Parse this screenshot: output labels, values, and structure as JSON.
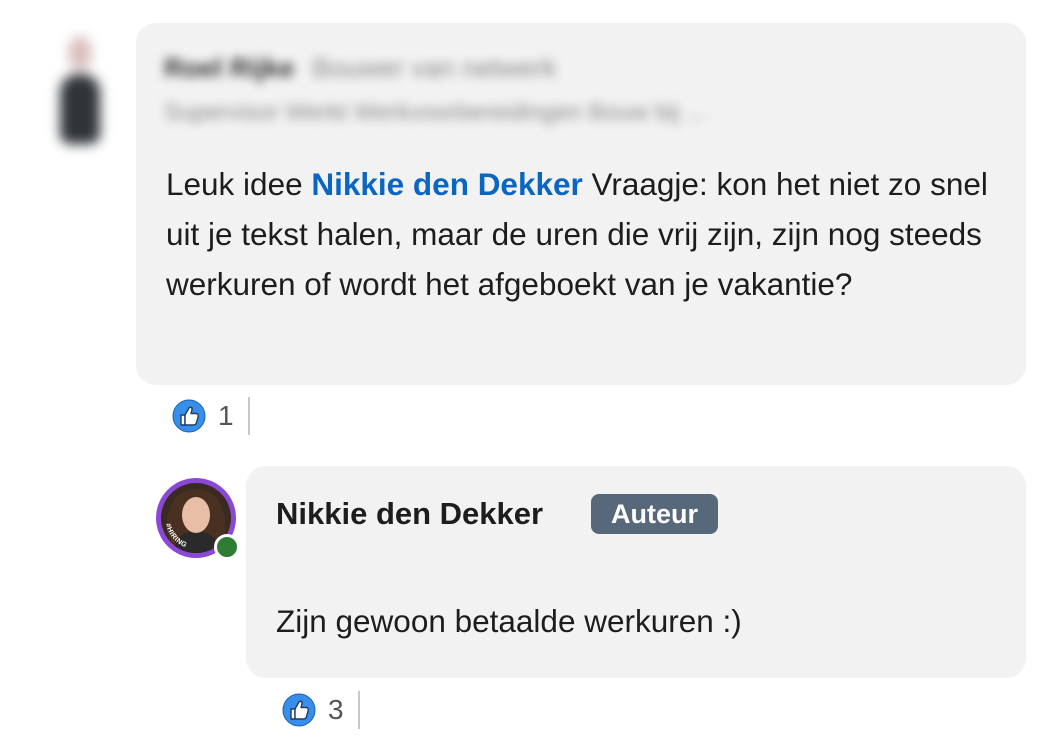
{
  "comment": {
    "author_name": "Roel Rijke",
    "author_headline": "Bouwer van netwerk",
    "author_subline": "Supervisor Werkt Werkvoorbereidingen Bouw bij ...",
    "text_before": "Leuk idee ",
    "mention": "Nikkie den Dekker",
    "text_after": " Vraagje: kon het niet zo snel uit je tekst halen, maar de uren die vrij zijn, zijn nog steeds werkuren of wordt het afgeboekt van je vakantie?",
    "reaction_icon": "like-icon",
    "reaction_count": "1"
  },
  "reply": {
    "author_name": "Nikkie den Dekker",
    "badge": "Auteur",
    "avatar_ring_text": "#HIRING",
    "status": "online",
    "text": "Zijn gewoon betaalde werkuren :)",
    "reaction_icon": "like-icon",
    "reaction_count": "3"
  },
  "colors": {
    "mention": "#0a66c2",
    "bubble": "#f2f2f2",
    "badge": "#56687a",
    "online": "#2f7d32",
    "hiring_ring": "#8a48d6",
    "like": "#378fe9"
  }
}
